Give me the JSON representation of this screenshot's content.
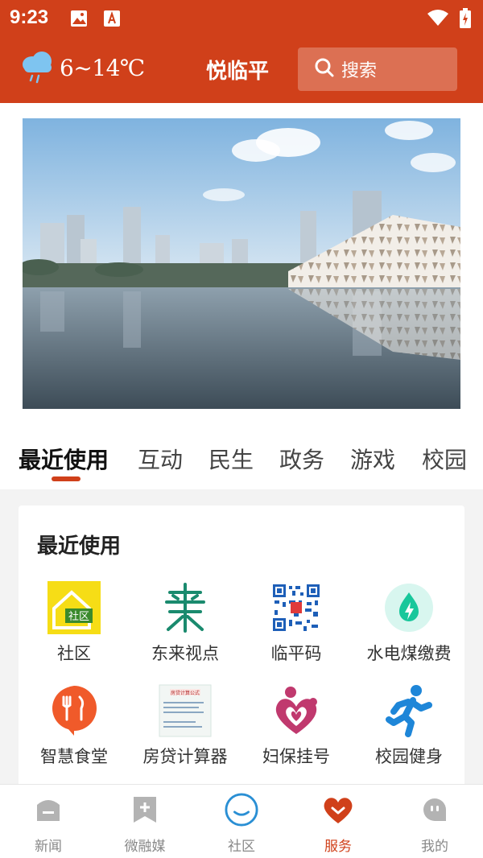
{
  "status_bar": {
    "time": "9:23"
  },
  "header": {
    "temperature": "6~14℃",
    "title": "悦临平",
    "search_label": "搜索"
  },
  "tabs": [
    {
      "label": "最近使用",
      "active": true
    },
    {
      "label": "互动"
    },
    {
      "label": "民生"
    },
    {
      "label": "政务"
    },
    {
      "label": "游戏"
    },
    {
      "label": "校园"
    }
  ],
  "recent_section": {
    "title": "最近使用",
    "items": [
      {
        "label": "社区",
        "icon": "community-icon"
      },
      {
        "label": "东来视点",
        "icon": "donglai-viewpoint-icon"
      },
      {
        "label": "临平码",
        "icon": "qr-code-icon"
      },
      {
        "label": "水电煤缴费",
        "icon": "utility-payment-icon"
      },
      {
        "label": "智慧食堂",
        "icon": "canteen-icon"
      },
      {
        "label": "房贷计算器",
        "icon": "mortgage-calculator-icon"
      },
      {
        "label": "妇保挂号",
        "icon": "maternal-registration-icon"
      },
      {
        "label": "校园健身",
        "icon": "campus-fitness-icon"
      }
    ],
    "icon_texts": {
      "community": "社区",
      "mortgage": "房贷计算公式"
    }
  },
  "bottom_nav": [
    {
      "label": "新闻"
    },
    {
      "label": "微融媒"
    },
    {
      "label": "社区"
    },
    {
      "label": "服务",
      "active": true
    },
    {
      "label": "我的"
    }
  ],
  "colors": {
    "brand": "#d0401a",
    "green": "#1a8a6e",
    "pink": "#c0396e",
    "blue": "#1e86d8"
  }
}
